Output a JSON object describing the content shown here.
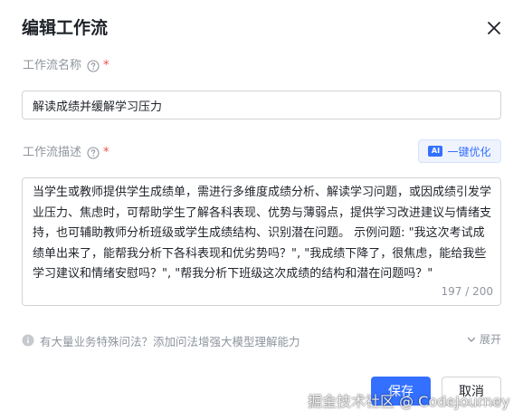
{
  "dialog": {
    "title": "编辑工作流"
  },
  "name_field": {
    "label": "工作流名称",
    "required_mark": "*",
    "value": "解读成绩并缓解学习压力"
  },
  "desc_field": {
    "label": "工作流描述",
    "required_mark": "*",
    "optimize_badge": "AI",
    "optimize_label": "一键优化",
    "value": "当学生或教师提供学生成绩单，需进行多维度成绩分析、解读学习问题，或因成绩引发学业压力、焦虑时，可帮助学生了解各科表现、优势与薄弱点，提供学习改进建议与情绪支持，也可辅助教师分析班级或学生成绩结构、识别潜在问题。 示例问题: \"我这次考试成绩单出来了，能帮我分析下各科表现和优劣势吗？\", \"我成绩下降了，很焦虑，能给我些学习建议和情绪安慰吗？\", \"帮我分析下班级这次成绩的结构和潜在问题吗？\"",
    "counter": "197 / 200"
  },
  "hint": {
    "text": "有大量业务特殊问法？添加问法增强大模型理解能力",
    "expand_label": "展开"
  },
  "footer": {
    "save_label": "保存",
    "cancel_label": "取消"
  },
  "watermark": "掘金技术社区 @ CodeJourney",
  "colors": {
    "primary": "#3370ff",
    "required": "#f54a45",
    "muted_text": "#8f959e",
    "border": "#d0d3d6"
  },
  "icons": {
    "close": "close-icon",
    "help": "question-circle-icon",
    "info": "info-circle-icon",
    "expand": "chevron-down-icon"
  }
}
